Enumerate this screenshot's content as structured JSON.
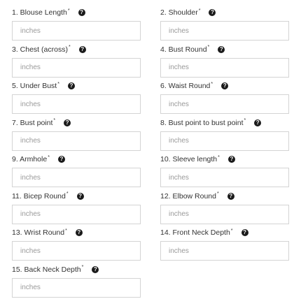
{
  "required_mark": "*",
  "help_glyph": "?",
  "fields": [
    {
      "label": "1. Blouse Length",
      "placeholder": "inches",
      "value": ""
    },
    {
      "label": "2. Shoulder",
      "placeholder": "inches",
      "value": ""
    },
    {
      "label": "3. Chest (across)",
      "placeholder": "inches",
      "value": ""
    },
    {
      "label": "4. Bust Round",
      "placeholder": "inches",
      "value": ""
    },
    {
      "label": "5. Under Bust",
      "placeholder": "inches",
      "value": ""
    },
    {
      "label": "6. Waist Round",
      "placeholder": "inches",
      "value": ""
    },
    {
      "label": "7. Bust point",
      "placeholder": "inches",
      "value": ""
    },
    {
      "label": "8. Bust point to bust point",
      "placeholder": "inches",
      "value": ""
    },
    {
      "label": "9. Armhole",
      "placeholder": "inches",
      "value": ""
    },
    {
      "label": "10. Sleeve length",
      "placeholder": "inches",
      "value": ""
    },
    {
      "label": "11. Bicep Round",
      "placeholder": "inches",
      "value": ""
    },
    {
      "label": "12. Elbow Round",
      "placeholder": "inches",
      "value": ""
    },
    {
      "label": "13. Wrist Round",
      "placeholder": "inches",
      "value": ""
    },
    {
      "label": "14. Front Neck Depth",
      "placeholder": "inches",
      "value": ""
    },
    {
      "label": "15. Back Neck Depth",
      "placeholder": "inches",
      "value": ""
    }
  ]
}
